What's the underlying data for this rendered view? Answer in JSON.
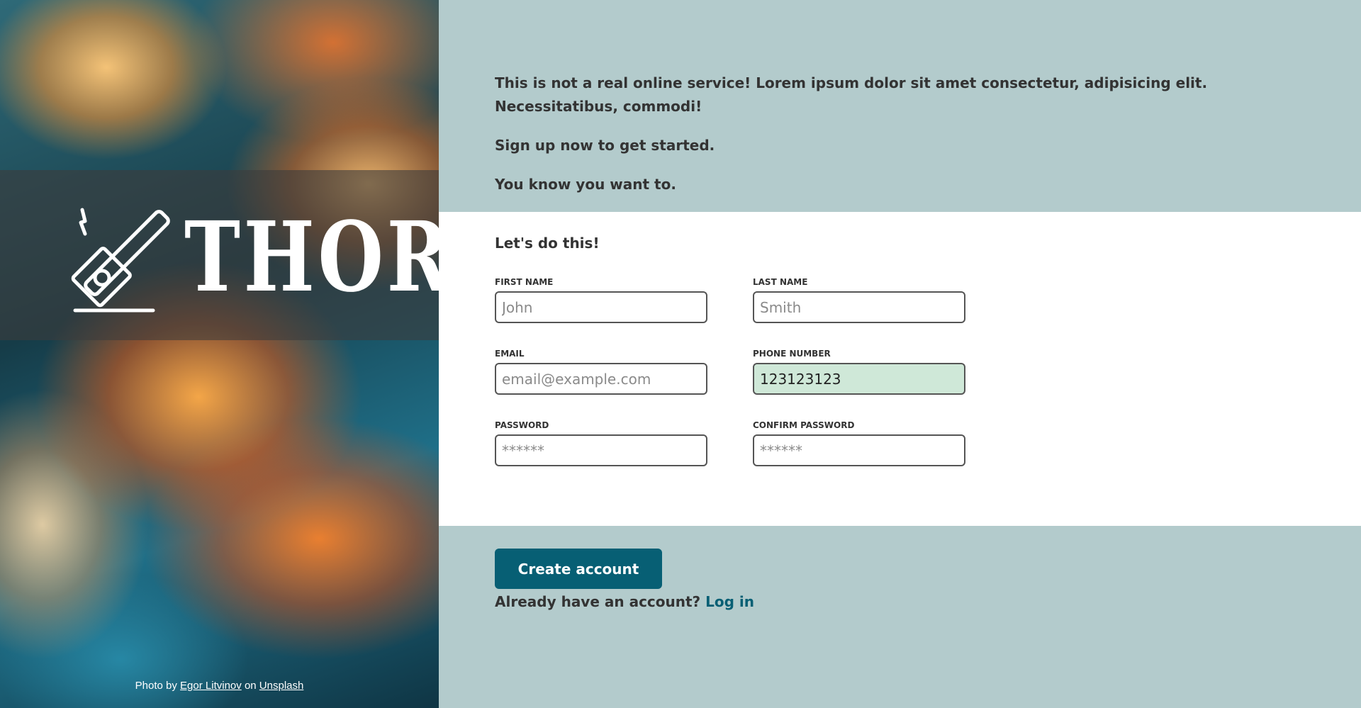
{
  "brand": {
    "logo_text": "THOR",
    "logo_icon": "hammer-icon"
  },
  "photo_credit": {
    "prefix": "Photo by",
    "author": "Egor Litvinov",
    "middle": "on",
    "source": "Unsplash"
  },
  "intro": {
    "line1": "This is not a real online service! Lorem ipsum dolor sit amet consectetur, adipisicing elit. Necessitatibus, commodi!",
    "line2": "Sign up now to get started.",
    "line3": "You know you want to."
  },
  "form": {
    "title": "Let's do this!",
    "first_name": {
      "label": "First Name",
      "placeholder": "John",
      "value": ""
    },
    "last_name": {
      "label": "Last Name",
      "placeholder": "Smith",
      "value": ""
    },
    "email": {
      "label": "Email",
      "placeholder": "email@example.com",
      "value": ""
    },
    "phone": {
      "label": "Phone Number",
      "placeholder": "",
      "value": "123123123"
    },
    "password": {
      "label": "Password",
      "placeholder": "******",
      "value": ""
    },
    "confirm_password": {
      "label": "Confirm Password",
      "placeholder": "******",
      "value": ""
    }
  },
  "actions": {
    "create_label": "Create account",
    "login_prompt": "Already have an account?",
    "login_link": "Log in"
  },
  "colors": {
    "panel_bg": "#b3cbcc",
    "accent": "#075f74",
    "valid_field": "#cfe8d8"
  }
}
